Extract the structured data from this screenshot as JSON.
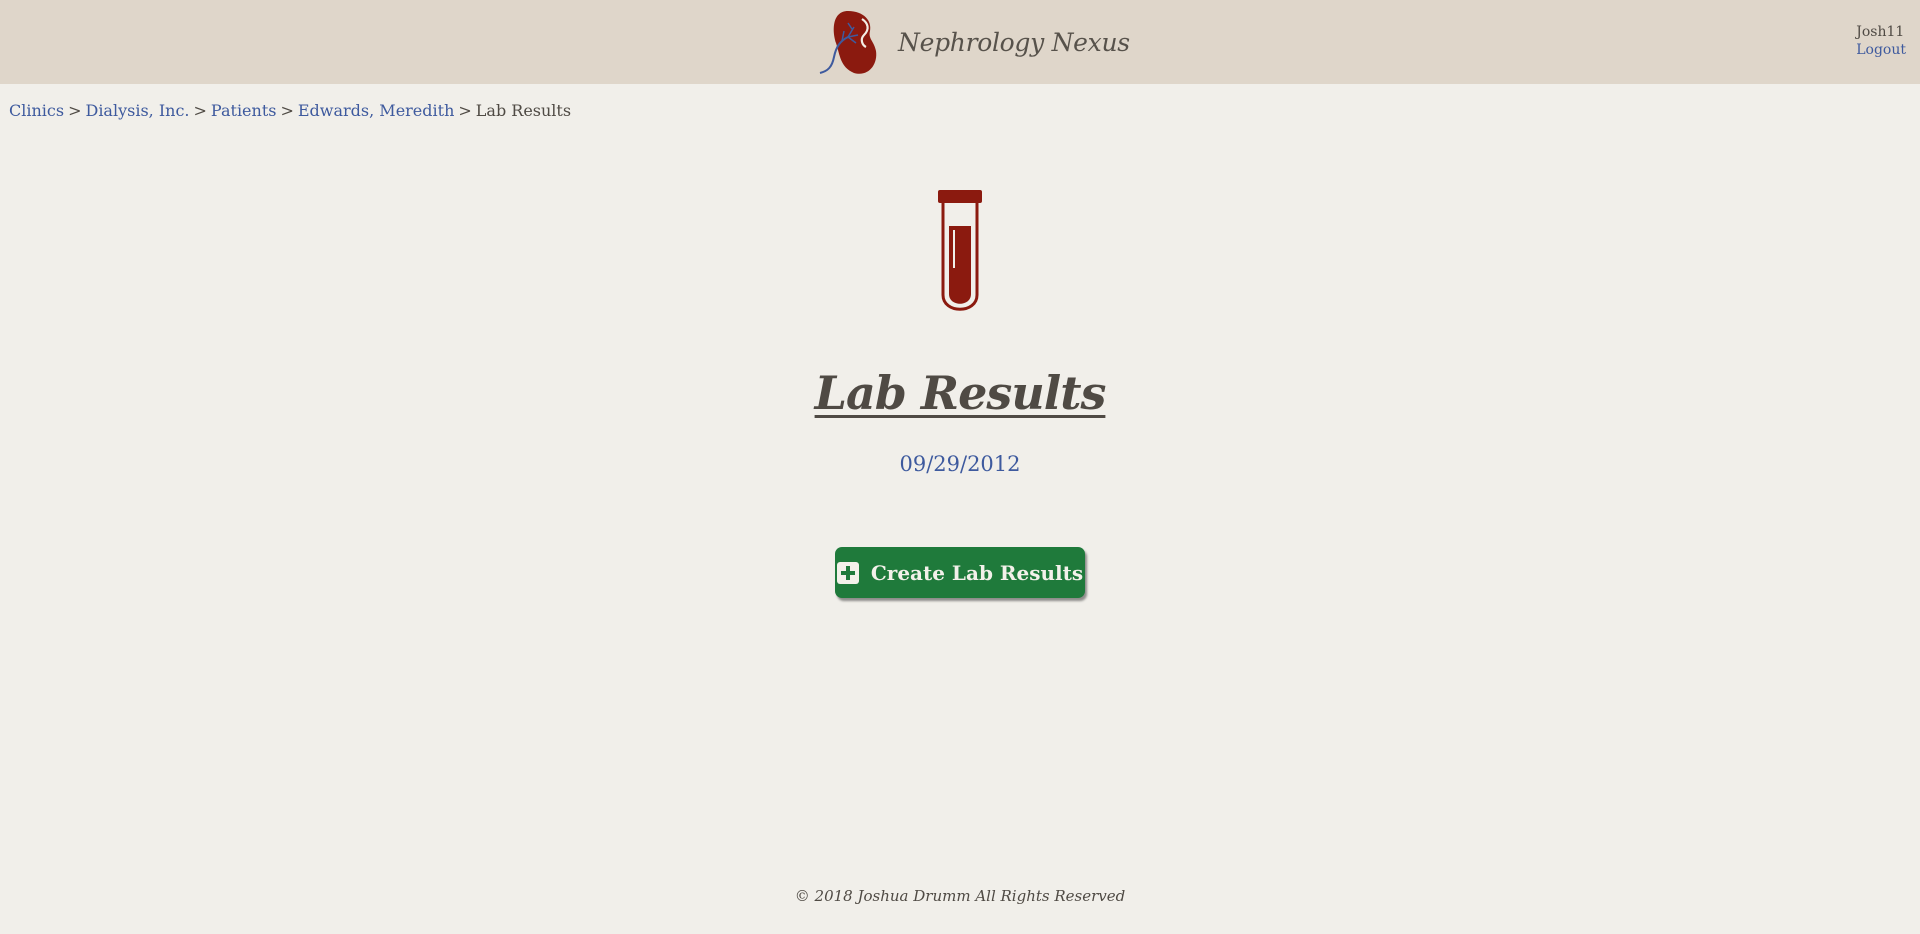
{
  "header": {
    "brand_name": "Nephrology Nexus",
    "logo_icon": "kidney-icon",
    "user_name": "Josh11",
    "logout_label": "Logout"
  },
  "breadcrumb": {
    "items": [
      "Clinics",
      "Dialysis, Inc.",
      "Patients",
      "Edwards, Meredith"
    ],
    "current": "Lab Results",
    "separator": ">"
  },
  "main": {
    "icon": "test-tube-icon",
    "title": "Lab Results",
    "dates": [
      "09/29/2012"
    ],
    "create_button_label": "Create Lab Results",
    "create_button_icon": "plus-square-icon"
  },
  "footer": {
    "copyright": "© 2018 Joshua Drumm All Rights Reserved"
  },
  "colors": {
    "header_bg": "#dfd6ca",
    "page_bg": "#f1efea",
    "link": "#3e5a9e",
    "accent_red": "#8b1a0f",
    "button_green": "#1f7a3b",
    "text": "#4f4a44"
  }
}
